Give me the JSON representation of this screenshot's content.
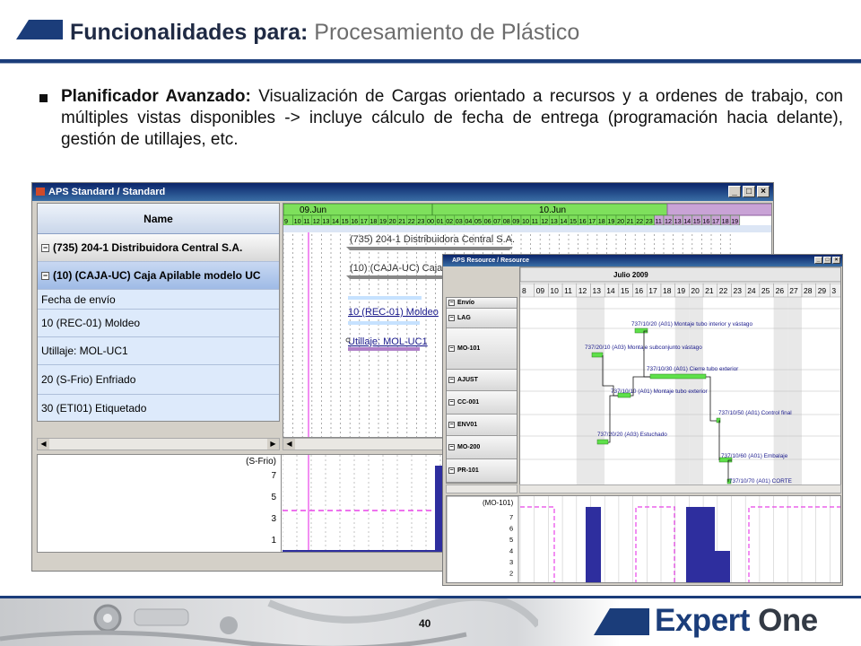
{
  "slide": {
    "title_bold": "Funcionalidades para:",
    "title_sub": "Procesamiento de Plástico",
    "bullet_bold": "Planificador Avanzado:",
    "bullet_text": " Visualización de Cargas orientado a recursos y a ordenes de trabajo, con múltiples vistas disponibles -> incluye cálculo de fecha de entrega (programación hacia delante), gestión de utillajes, etc.",
    "page_number": "40",
    "logo_word1": "Expert",
    "logo_word2": "One"
  },
  "window1": {
    "title": "APS Standard / Standard",
    "buttons": [
      "_",
      "□",
      "×"
    ],
    "name_header": "Name",
    "rows": [
      {
        "label": "(735) 204-1 Distribuidora Central S.A.",
        "kind": "grp"
      },
      {
        "label": "(10) (CAJA-UC) Caja Apilable modelo UC",
        "kind": "grp2"
      },
      {
        "label": "Fecha de envío",
        "kind": "sub"
      },
      {
        "label": "10 (REC-01) Moldeo",
        "kind": "sub"
      },
      {
        "label": "Utillaje: MOL-UC1",
        "kind": "sub"
      },
      {
        "label": "20 (S-Frio) Enfriado",
        "kind": "sub"
      },
      {
        "label": "30 (ETI01) Etiquetado",
        "kind": "sub"
      }
    ],
    "day1": "09.Jun",
    "day2": "10.Jun",
    "hours": [
      "9",
      "10",
      "11",
      "12",
      "13",
      "14",
      "15",
      "16",
      "17",
      "18",
      "19",
      "20",
      "21",
      "22",
      "23",
      "00",
      "01",
      "02",
      "03",
      "04",
      "05",
      "06",
      "07",
      "08",
      "09",
      "10",
      "11",
      "12",
      "13",
      "14",
      "15",
      "16",
      "17",
      "18",
      "19",
      "20",
      "21",
      "22",
      "23",
      "11",
      "12",
      "13",
      "14",
      "15",
      "16",
      "17",
      "18",
      "19"
    ],
    "gantt_labels": [
      "(735) 204-1 Distribuidora Central S.A.",
      "(10) (CAJA-UC) Caja",
      "10 (REC-01) Moldeo",
      "Utillaje: MOL-UC1"
    ],
    "load_title": "(S-Frio)",
    "load_ticks": [
      "7",
      "5",
      "3",
      "1"
    ]
  },
  "window2": {
    "title": "APS Resource / Resource",
    "buttons": [
      "_",
      "□",
      "×"
    ],
    "month": "Julio 2009",
    "days": [
      "8",
      "09",
      "10",
      "11",
      "12",
      "13",
      "14",
      "15",
      "16",
      "17",
      "18",
      "19",
      "20",
      "21",
      "22",
      "23",
      "24",
      "25",
      "26",
      "27",
      "28",
      "29",
      "3"
    ],
    "resources": [
      "Envío",
      "LAG",
      "MO-101",
      "AJUST",
      "CC-001",
      "ENV01",
      "MO-200",
      "PR-101"
    ],
    "tasks": [
      "737/10/20 (A01) Montaje tubo interior y vástago",
      "737/20/10 (A03) Montaje subconjunto vástago",
      "737/10/30 (A01) Cierre tubo exterior",
      "737/10/10 (A01) Montaje tubo exterior",
      "737/10/50 (A01) Control final",
      "737/20/20 (A03) Estuchado",
      "737/10/60 (A01) Embalaje",
      "737/10/70 (A01) CORTE"
    ],
    "load_title": "(MO-101)",
    "load_ticks": [
      "7",
      "6",
      "5",
      "4",
      "3",
      "2"
    ]
  },
  "colors": {
    "brand_navy": "#1b3d7a",
    "gantt_green": "#5ee04a",
    "load_bar": "#2e2e9e",
    "limit_line": "#e844e8"
  }
}
